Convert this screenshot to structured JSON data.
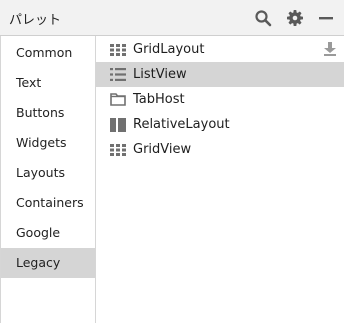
{
  "header": {
    "title": "パレット",
    "icons": [
      "search-icon",
      "gear-icon",
      "minimize-icon"
    ]
  },
  "categories": [
    {
      "label": "Common",
      "selected": false
    },
    {
      "label": "Text",
      "selected": false
    },
    {
      "label": "Buttons",
      "selected": false
    },
    {
      "label": "Widgets",
      "selected": false
    },
    {
      "label": "Layouts",
      "selected": false
    },
    {
      "label": "Containers",
      "selected": false
    },
    {
      "label": "Google",
      "selected": false
    },
    {
      "label": "Legacy",
      "selected": true
    }
  ],
  "items": [
    {
      "label": "GridLayout",
      "icon": "grid-icon",
      "selected": false
    },
    {
      "label": "ListView",
      "icon": "list-icon",
      "selected": true
    },
    {
      "label": "TabHost",
      "icon": "tab-icon",
      "selected": false
    },
    {
      "label": "RelativeLayout",
      "icon": "relative-layout-icon",
      "selected": false
    },
    {
      "label": "GridView",
      "icon": "grid-icon",
      "selected": false
    }
  ],
  "colors": {
    "selected_bg": "#d5d5d5",
    "icon": "#707070"
  }
}
